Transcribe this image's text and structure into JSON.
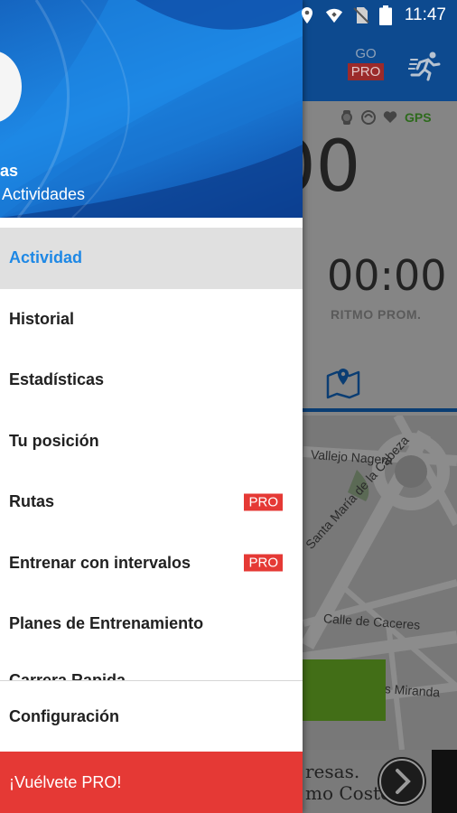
{
  "status_bar": {
    "time": "11:47",
    "icons": [
      "location-icon",
      "wifi-icon",
      "no-sim-icon",
      "battery-icon"
    ]
  },
  "toolbar": {
    "go_text": "GO",
    "pro_text": "PRO",
    "run_icon": "runner-icon"
  },
  "workout": {
    "duration_partial": "00",
    "avg_pace_value": "00:00",
    "avg_pace_label": "RITMO PROM.",
    "gps_label": "GPS"
  },
  "map": {
    "streets": [
      "Vallejo Nagera",
      "Santa María de la Cabeza",
      "Calle de Caceres",
      "es Miranda"
    ]
  },
  "ad": {
    "line1": "resas.",
    "line2": "mo Coste"
  },
  "drawer": {
    "user_name_partial": "as",
    "user_activities": "Actividades",
    "items": [
      {
        "label": "Actividad",
        "active": true
      },
      {
        "label": "Historial"
      },
      {
        "label": "Estadísticas"
      },
      {
        "label": "Tu posición"
      },
      {
        "label": "Rutas",
        "badge": "PRO"
      },
      {
        "label": "Entrenar con intervalos",
        "badge": "PRO"
      },
      {
        "label": "Planes de Entrenamiento"
      }
    ],
    "cut_item": "Carrera Rapida",
    "settings_label": "Configuración",
    "go_pro_label": "¡Vuélvete PRO!"
  },
  "colors": {
    "accent": "#1e88e5",
    "pro_red": "#e53935",
    "header_blue": "#1565c0"
  }
}
